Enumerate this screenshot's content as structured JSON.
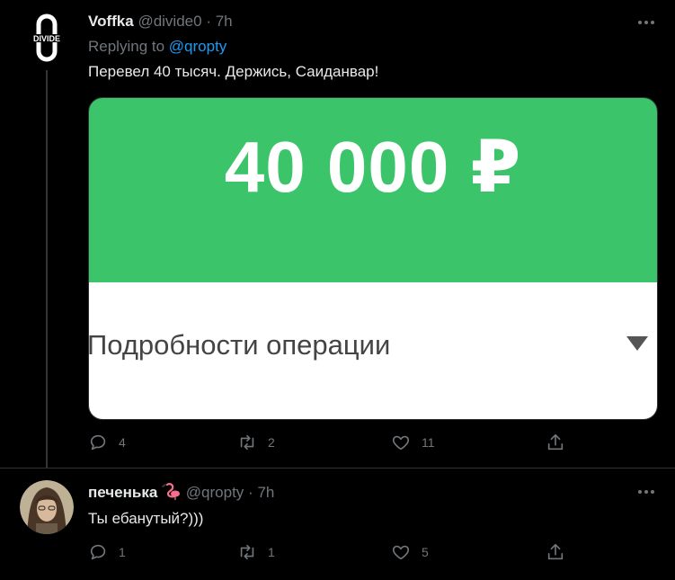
{
  "tweet1": {
    "display_name": "Voffka",
    "handle": "@divide0",
    "separator": "·",
    "time": "7h",
    "replying_to_prefix": "Replying to",
    "replying_to_handle": "@qropty",
    "text": "Перевел 40 тысяч. Держись, Саиданвар!",
    "avatar_text": "DIVIDE",
    "media": {
      "amount": "40 000 ₽",
      "detail_label": "Подробности операции"
    },
    "replies": "4",
    "retweets": "2",
    "likes": "11"
  },
  "tweet2": {
    "display_name": "печенька",
    "handle": "@qropty",
    "separator": "·",
    "time": "7h",
    "text": "Ты ебанутый?)))",
    "replies": "1",
    "retweets": "1",
    "likes": "5"
  },
  "icons": {
    "more": "more-icon",
    "reply": "reply-icon",
    "retweet": "retweet-icon",
    "like": "heart-icon",
    "share": "share-icon",
    "flamingo": "flamingo-emoji"
  },
  "colors": {
    "background": "#000000",
    "link": "#1d9bf0",
    "muted": "#71767b",
    "card_green": "#3cc46a"
  }
}
